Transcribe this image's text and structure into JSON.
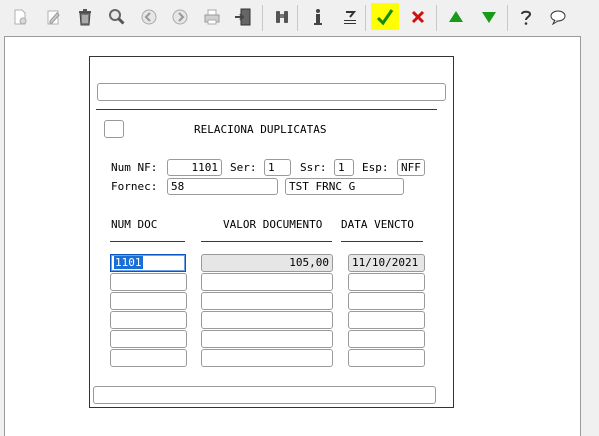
{
  "toolbar": {
    "icons": [
      "new-icon",
      "edit-icon",
      "trash-icon",
      "search-icon",
      "prev-icon",
      "next-icon",
      "print-icon",
      "exit-icon",
      "binoculars-icon",
      "info-icon",
      "tools-icon",
      "confirm-check-icon",
      "cancel-x-icon",
      "up-arrow-icon",
      "down-arrow-icon",
      "help-icon",
      "chat-icon"
    ],
    "highlight_color": "#ffff00"
  },
  "form": {
    "top_field_value": "",
    "title": "RELACIONA DUPLICATAS",
    "num_nf_label": "Num NF:",
    "num_nf_value": "1101",
    "ser_label": "Ser:",
    "ser_value": "1",
    "ssr_label": "Ssr:",
    "ssr_value": "1",
    "esp_label": "Esp:",
    "esp_value": "NFF",
    "fornec_label": "Fornec:",
    "fornec_value": "58",
    "fornec_name": "TST FRNC G",
    "columns": [
      "NUM DOC",
      "VALOR DOCUMENTO",
      "DATA VENCTO"
    ],
    "rows": [
      {
        "num_doc": "1101",
        "valor": "105,00",
        "data": "11/10/2021"
      },
      {
        "num_doc": "",
        "valor": "",
        "data": ""
      },
      {
        "num_doc": "",
        "valor": "",
        "data": ""
      },
      {
        "num_doc": "",
        "valor": "",
        "data": ""
      },
      {
        "num_doc": "",
        "valor": "",
        "data": ""
      },
      {
        "num_doc": "",
        "valor": "",
        "data": ""
      }
    ],
    "bottom_field_value": ""
  }
}
